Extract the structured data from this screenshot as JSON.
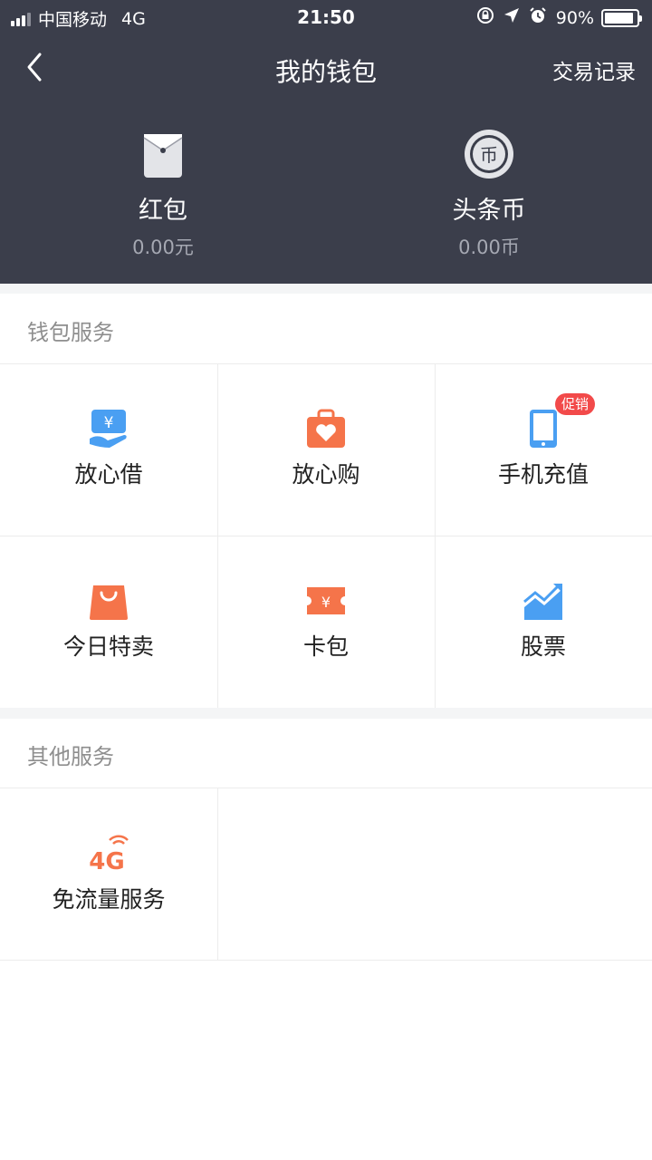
{
  "status_bar": {
    "carrier": "中国移动",
    "network": "4G",
    "time": "21:50",
    "battery": "90%",
    "battery_level": 0.9
  },
  "nav": {
    "title": "我的钱包",
    "right_link": "交易记录",
    "back_icon": "chevron-left-icon"
  },
  "wallet": [
    {
      "name": "红包",
      "value": "0.00元",
      "icon": "red-envelope-icon"
    },
    {
      "name": "头条币",
      "value": "0.00币",
      "icon": "coin-icon",
      "icon_text": "币"
    }
  ],
  "wallet_services": {
    "title": "钱包服务",
    "items": [
      {
        "label": "放心借",
        "icon": "loan-icon",
        "icon_text": "¥"
      },
      {
        "label": "放心购",
        "icon": "heart-bag-icon"
      },
      {
        "label": "手机充值",
        "icon": "phone-icon",
        "badge": "促销"
      },
      {
        "label": "今日特卖",
        "icon": "shopping-bag-icon"
      },
      {
        "label": "卡包",
        "icon": "ticket-icon",
        "icon_text": "¥"
      },
      {
        "label": "股票",
        "icon": "stock-chart-icon"
      }
    ]
  },
  "other_services": {
    "title": "其他服务",
    "items": [
      {
        "label": "免流量服务",
        "icon": "4g-icon",
        "icon_text": "4G"
      }
    ]
  },
  "colors": {
    "header_bg": "#3b3e4b",
    "icon_orange": "#f5744a",
    "icon_blue": "#4a9ff2",
    "badge_red": "#f24a4a",
    "divider": "#ececec",
    "section_bg": "#f4f5f6"
  }
}
